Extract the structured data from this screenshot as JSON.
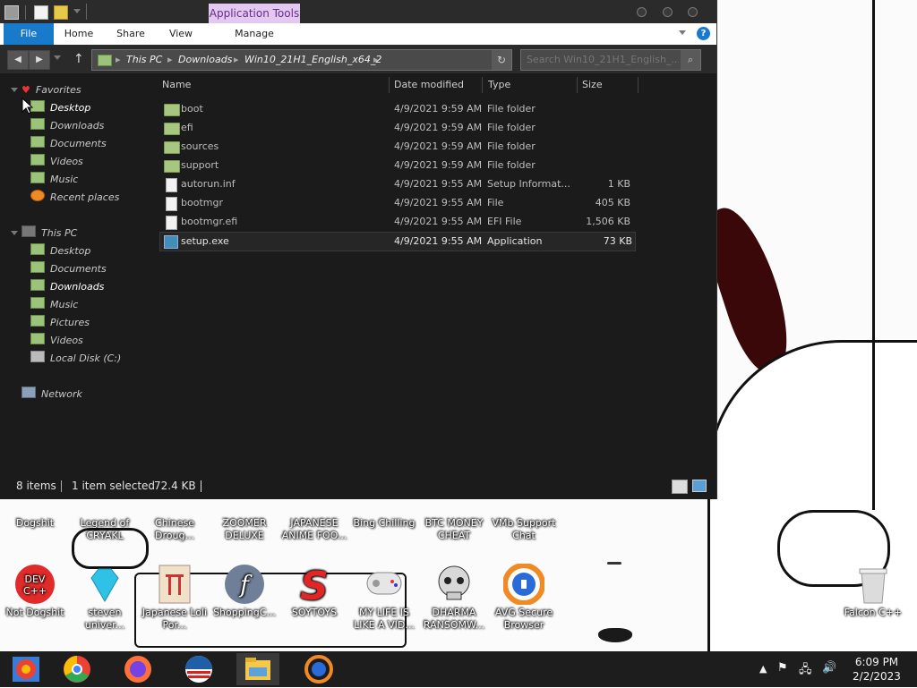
{
  "window": {
    "app_tools_label": "Application Tools",
    "ribbon_tabs": [
      "File",
      "Home",
      "Share",
      "View",
      "Manage"
    ],
    "address": {
      "crumbs": [
        "This PC",
        "Downloads",
        "Win10_21H1_English_x64_2"
      ]
    },
    "search": {
      "placeholder": "Search Win10_21H1_English_..."
    }
  },
  "navpane": {
    "favorites_label": "Favorites",
    "favorites": [
      "Desktop",
      "Downloads",
      "Documents",
      "Videos",
      "Music",
      "Recent places"
    ],
    "thispc_label": "This PC",
    "thispc": [
      "Desktop",
      "Documents",
      "Downloads",
      "Music",
      "Pictures",
      "Videos",
      "Local Disk (C:)"
    ],
    "network_label": "Network"
  },
  "columns": [
    "Name",
    "Date modified",
    "Type",
    "Size"
  ],
  "files": [
    {
      "name": "boot",
      "date": "4/9/2021 9:59 AM",
      "type": "File folder",
      "size": "",
      "kind": "folder"
    },
    {
      "name": "efi",
      "date": "4/9/2021 9:59 AM",
      "type": "File folder",
      "size": "",
      "kind": "folder"
    },
    {
      "name": "sources",
      "date": "4/9/2021 9:59 AM",
      "type": "File folder",
      "size": "",
      "kind": "folder"
    },
    {
      "name": "support",
      "date": "4/9/2021 9:59 AM",
      "type": "File folder",
      "size": "",
      "kind": "folder"
    },
    {
      "name": "autorun.inf",
      "date": "4/9/2021 9:55 AM",
      "type": "Setup Informat...",
      "size": "1 KB",
      "kind": "file"
    },
    {
      "name": "bootmgr",
      "date": "4/9/2021 9:55 AM",
      "type": "File",
      "size": "405 KB",
      "kind": "file"
    },
    {
      "name": "bootmgr.efi",
      "date": "4/9/2021 9:55 AM",
      "type": "EFI File",
      "size": "1,506 KB",
      "kind": "file"
    },
    {
      "name": "setup.exe",
      "date": "4/9/2021 9:55 AM",
      "type": "Application",
      "size": "73 KB",
      "kind": "exe"
    }
  ],
  "status": {
    "items": "8 items",
    "selected": "1 item selected",
    "size": "72.4 KB"
  },
  "desktop_icons_row1": [
    "Dogshit",
    "Legend of CRYAKL",
    "Chinese Droug...",
    "ZOOMER DELUXE",
    "JAPANESE ANIME FOO...",
    "Bing Chilling",
    "BTC MONEY CHEAT",
    "VMb Support Chat"
  ],
  "desktop_icons_row2": [
    "Not Dogshit",
    "steven univer...",
    "Japanese Loli Por...",
    "ShoppingC...",
    "SOYTOYS",
    "MY LIFE IS LIKE A VID...",
    "DHARMA RANSOMW...",
    "AVG Secure Browser"
  ],
  "recycle_label": "Falcon C++",
  "clock": {
    "time": "6:09 PM",
    "date": "2/2/2023"
  },
  "colors": {
    "file_tab": "#1979ca",
    "app_tools_bg": "#e3c8f2",
    "window_bg": "#1b1b1b"
  }
}
